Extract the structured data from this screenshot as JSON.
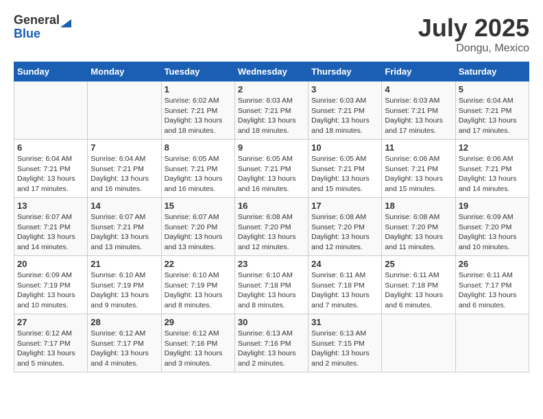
{
  "header": {
    "logo": {
      "general": "General",
      "blue": "Blue"
    },
    "title": "July 2025",
    "subtitle": "Dongu, Mexico"
  },
  "weekdays": [
    "Sunday",
    "Monday",
    "Tuesday",
    "Wednesday",
    "Thursday",
    "Friday",
    "Saturday"
  ],
  "weeks": [
    [
      {
        "day": "",
        "sunrise": "",
        "sunset": "",
        "daylight": ""
      },
      {
        "day": "",
        "sunrise": "",
        "sunset": "",
        "daylight": ""
      },
      {
        "day": "1",
        "sunrise": "Sunrise: 6:02 AM",
        "sunset": "Sunset: 7:21 PM",
        "daylight": "Daylight: 13 hours and 18 minutes."
      },
      {
        "day": "2",
        "sunrise": "Sunrise: 6:03 AM",
        "sunset": "Sunset: 7:21 PM",
        "daylight": "Daylight: 13 hours and 18 minutes."
      },
      {
        "day": "3",
        "sunrise": "Sunrise: 6:03 AM",
        "sunset": "Sunset: 7:21 PM",
        "daylight": "Daylight: 13 hours and 18 minutes."
      },
      {
        "day": "4",
        "sunrise": "Sunrise: 6:03 AM",
        "sunset": "Sunset: 7:21 PM",
        "daylight": "Daylight: 13 hours and 17 minutes."
      },
      {
        "day": "5",
        "sunrise": "Sunrise: 6:04 AM",
        "sunset": "Sunset: 7:21 PM",
        "daylight": "Daylight: 13 hours and 17 minutes."
      }
    ],
    [
      {
        "day": "6",
        "sunrise": "Sunrise: 6:04 AM",
        "sunset": "Sunset: 7:21 PM",
        "daylight": "Daylight: 13 hours and 17 minutes."
      },
      {
        "day": "7",
        "sunrise": "Sunrise: 6:04 AM",
        "sunset": "Sunset: 7:21 PM",
        "daylight": "Daylight: 13 hours and 16 minutes."
      },
      {
        "day": "8",
        "sunrise": "Sunrise: 6:05 AM",
        "sunset": "Sunset: 7:21 PM",
        "daylight": "Daylight: 13 hours and 16 minutes."
      },
      {
        "day": "9",
        "sunrise": "Sunrise: 6:05 AM",
        "sunset": "Sunset: 7:21 PM",
        "daylight": "Daylight: 13 hours and 16 minutes."
      },
      {
        "day": "10",
        "sunrise": "Sunrise: 6:05 AM",
        "sunset": "Sunset: 7:21 PM",
        "daylight": "Daylight: 13 hours and 15 minutes."
      },
      {
        "day": "11",
        "sunrise": "Sunrise: 6:06 AM",
        "sunset": "Sunset: 7:21 PM",
        "daylight": "Daylight: 13 hours and 15 minutes."
      },
      {
        "day": "12",
        "sunrise": "Sunrise: 6:06 AM",
        "sunset": "Sunset: 7:21 PM",
        "daylight": "Daylight: 13 hours and 14 minutes."
      }
    ],
    [
      {
        "day": "13",
        "sunrise": "Sunrise: 6:07 AM",
        "sunset": "Sunset: 7:21 PM",
        "daylight": "Daylight: 13 hours and 14 minutes."
      },
      {
        "day": "14",
        "sunrise": "Sunrise: 6:07 AM",
        "sunset": "Sunset: 7:21 PM",
        "daylight": "Daylight: 13 hours and 13 minutes."
      },
      {
        "day": "15",
        "sunrise": "Sunrise: 6:07 AM",
        "sunset": "Sunset: 7:20 PM",
        "daylight": "Daylight: 13 hours and 13 minutes."
      },
      {
        "day": "16",
        "sunrise": "Sunrise: 6:08 AM",
        "sunset": "Sunset: 7:20 PM",
        "daylight": "Daylight: 13 hours and 12 minutes."
      },
      {
        "day": "17",
        "sunrise": "Sunrise: 6:08 AM",
        "sunset": "Sunset: 7:20 PM",
        "daylight": "Daylight: 13 hours and 12 minutes."
      },
      {
        "day": "18",
        "sunrise": "Sunrise: 6:08 AM",
        "sunset": "Sunset: 7:20 PM",
        "daylight": "Daylight: 13 hours and 11 minutes."
      },
      {
        "day": "19",
        "sunrise": "Sunrise: 6:09 AM",
        "sunset": "Sunset: 7:20 PM",
        "daylight": "Daylight: 13 hours and 10 minutes."
      }
    ],
    [
      {
        "day": "20",
        "sunrise": "Sunrise: 6:09 AM",
        "sunset": "Sunset: 7:19 PM",
        "daylight": "Daylight: 13 hours and 10 minutes."
      },
      {
        "day": "21",
        "sunrise": "Sunrise: 6:10 AM",
        "sunset": "Sunset: 7:19 PM",
        "daylight": "Daylight: 13 hours and 9 minutes."
      },
      {
        "day": "22",
        "sunrise": "Sunrise: 6:10 AM",
        "sunset": "Sunset: 7:19 PM",
        "daylight": "Daylight: 13 hours and 8 minutes."
      },
      {
        "day": "23",
        "sunrise": "Sunrise: 6:10 AM",
        "sunset": "Sunset: 7:18 PM",
        "daylight": "Daylight: 13 hours and 8 minutes."
      },
      {
        "day": "24",
        "sunrise": "Sunrise: 6:11 AM",
        "sunset": "Sunset: 7:18 PM",
        "daylight": "Daylight: 13 hours and 7 minutes."
      },
      {
        "day": "25",
        "sunrise": "Sunrise: 6:11 AM",
        "sunset": "Sunset: 7:18 PM",
        "daylight": "Daylight: 13 hours and 6 minutes."
      },
      {
        "day": "26",
        "sunrise": "Sunrise: 6:11 AM",
        "sunset": "Sunset: 7:17 PM",
        "daylight": "Daylight: 13 hours and 6 minutes."
      }
    ],
    [
      {
        "day": "27",
        "sunrise": "Sunrise: 6:12 AM",
        "sunset": "Sunset: 7:17 PM",
        "daylight": "Daylight: 13 hours and 5 minutes."
      },
      {
        "day": "28",
        "sunrise": "Sunrise: 6:12 AM",
        "sunset": "Sunset: 7:17 PM",
        "daylight": "Daylight: 13 hours and 4 minutes."
      },
      {
        "day": "29",
        "sunrise": "Sunrise: 6:12 AM",
        "sunset": "Sunset: 7:16 PM",
        "daylight": "Daylight: 13 hours and 3 minutes."
      },
      {
        "day": "30",
        "sunrise": "Sunrise: 6:13 AM",
        "sunset": "Sunset: 7:16 PM",
        "daylight": "Daylight: 13 hours and 2 minutes."
      },
      {
        "day": "31",
        "sunrise": "Sunrise: 6:13 AM",
        "sunset": "Sunset: 7:15 PM",
        "daylight": "Daylight: 13 hours and 2 minutes."
      },
      {
        "day": "",
        "sunrise": "",
        "sunset": "",
        "daylight": ""
      },
      {
        "day": "",
        "sunrise": "",
        "sunset": "",
        "daylight": ""
      }
    ]
  ]
}
